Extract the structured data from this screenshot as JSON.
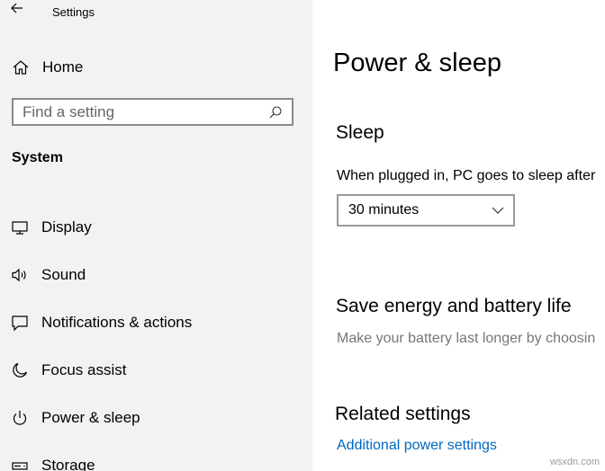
{
  "window": {
    "title": "Settings"
  },
  "sidebar": {
    "home_label": "Home",
    "search": {
      "placeholder": "Find a setting",
      "value": ""
    },
    "section_heading": "System",
    "items": [
      {
        "label": "Display",
        "icon": "monitor-icon"
      },
      {
        "label": "Sound",
        "icon": "speaker-icon"
      },
      {
        "label": "Notifications & actions",
        "icon": "message-icon"
      },
      {
        "label": "Focus assist",
        "icon": "moon-icon"
      },
      {
        "label": "Power & sleep",
        "icon": "power-icon"
      },
      {
        "label": "Storage",
        "icon": "storage-icon"
      }
    ]
  },
  "main": {
    "page_title": "Power & sleep",
    "sleep": {
      "title": "Sleep",
      "plugged_in_label": "When plugged in, PC goes to sleep after",
      "plugged_in_value": "30 minutes"
    },
    "energy": {
      "title": "Save energy and battery life",
      "description": "Make your battery last longer by choosin"
    },
    "related": {
      "title": "Related settings",
      "link": "Additional power settings"
    }
  },
  "watermark": "wsxdn.com",
  "colors": {
    "sidebar_bg": "#f2f2f2",
    "link": "#0067c0",
    "muted_text": "#767676"
  }
}
